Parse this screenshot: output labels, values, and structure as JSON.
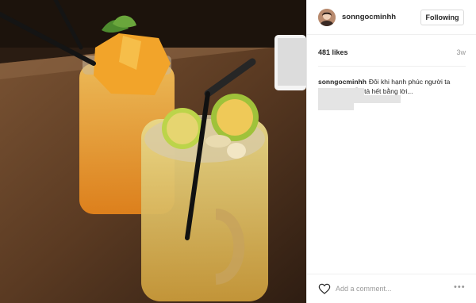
{
  "post": {
    "username": "sonngocminhh",
    "follow_label": "Following",
    "likes": "481 likes",
    "time_ago": "3w",
    "caption_username": "sonngocminhh",
    "caption_text": "Đôi khi hạnh phúc người ta không thể diễn tả hết bằng lời...",
    "comment_placeholder": "Add a comment...",
    "more_icon": "ellipsis-icon",
    "like_icon": "heart-outline-icon",
    "follow_border_color": "#dbdbdb",
    "photo_description_palette": [
      "#f0a020",
      "#7a4a2a",
      "#c8902a",
      "#3a2618"
    ]
  }
}
